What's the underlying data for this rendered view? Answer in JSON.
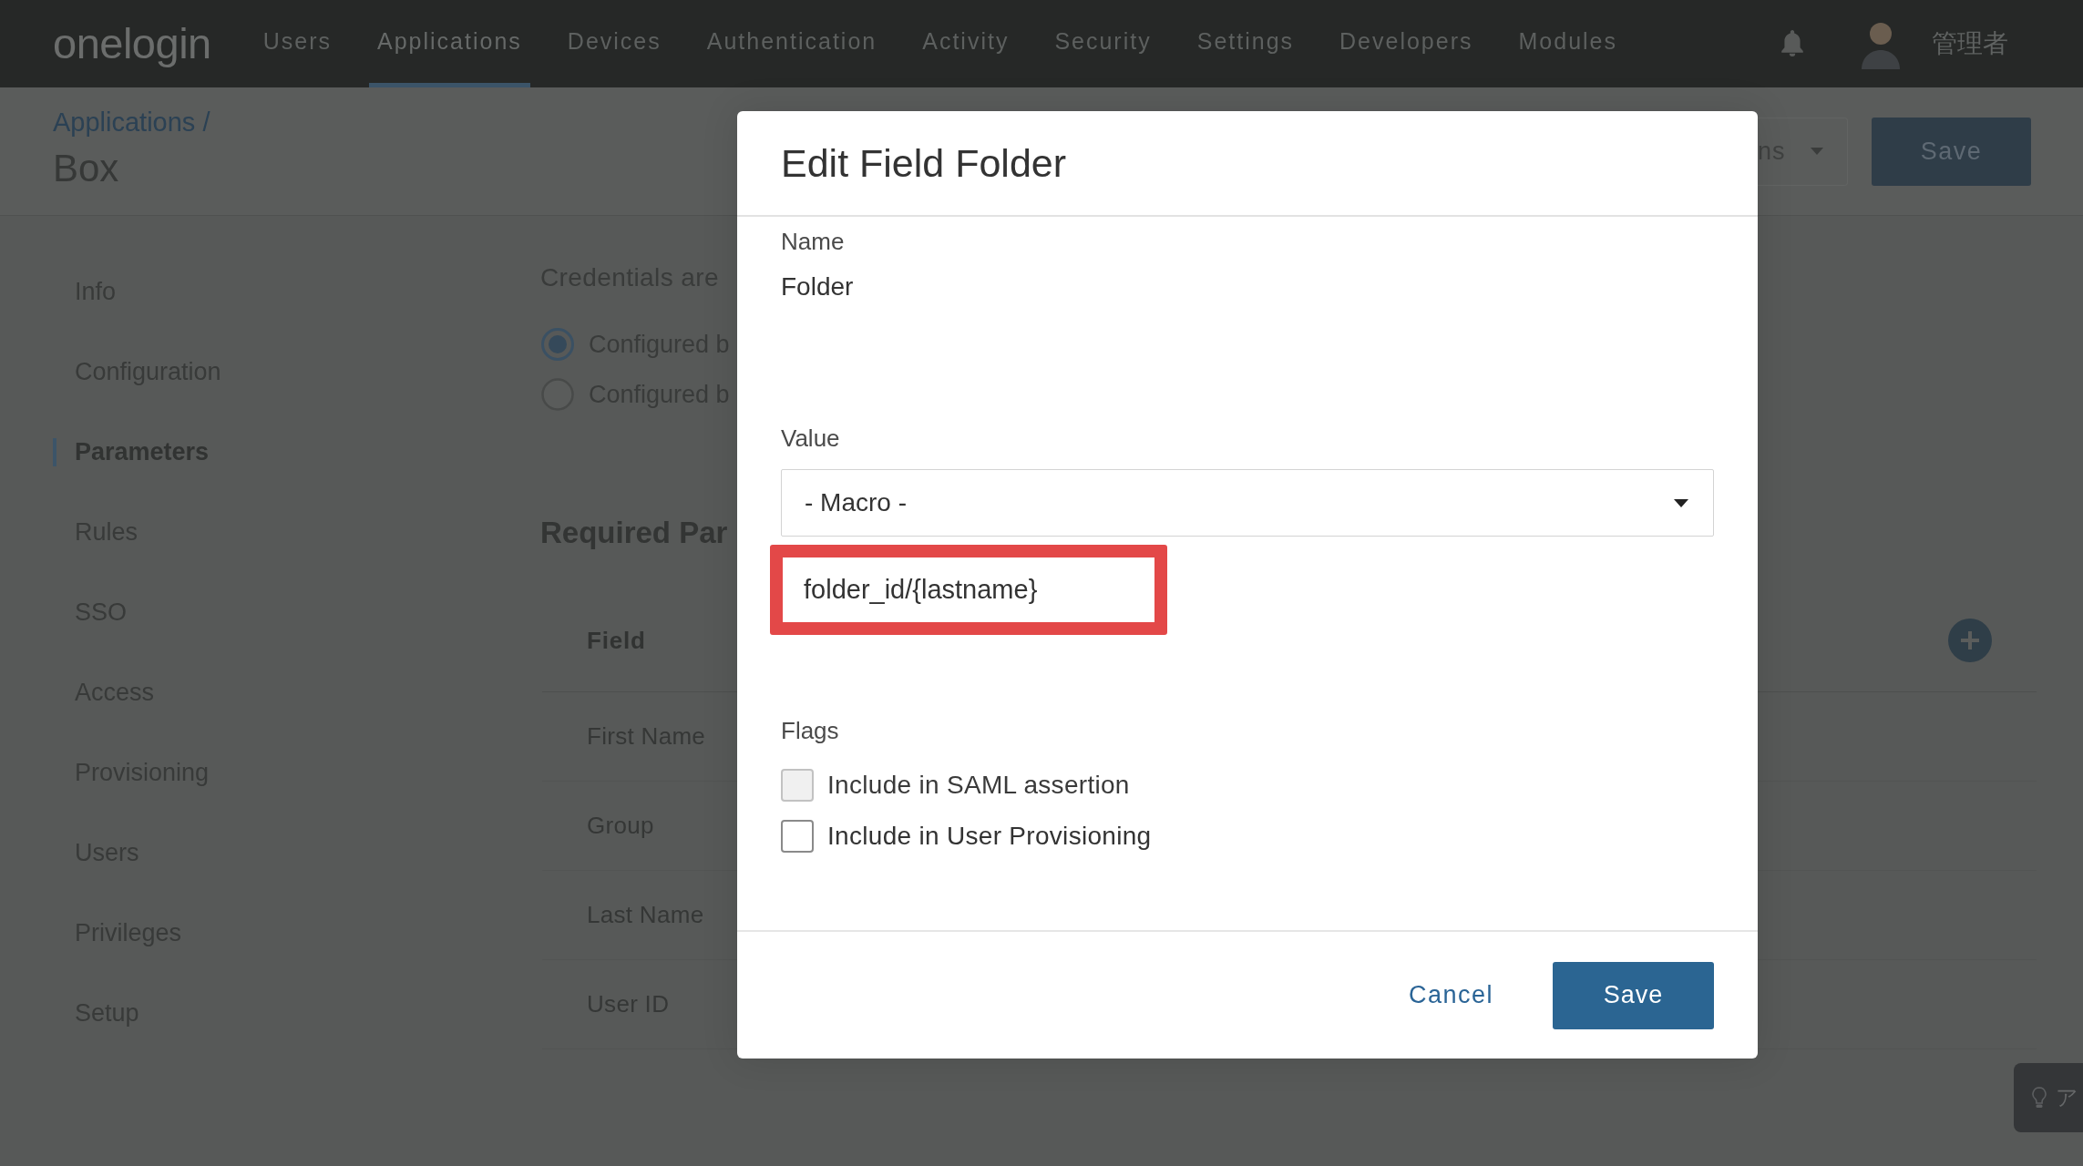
{
  "top_nav": {
    "logo": "onelogin",
    "tabs": [
      {
        "label": "Users",
        "selected": false
      },
      {
        "label": "Applications",
        "selected": true
      },
      {
        "label": "Devices",
        "selected": false
      },
      {
        "label": "Authentication",
        "selected": false
      },
      {
        "label": "Activity",
        "selected": false
      },
      {
        "label": "Security",
        "selected": false
      },
      {
        "label": "Settings",
        "selected": false
      },
      {
        "label": "Developers",
        "selected": false
      },
      {
        "label": "Modules",
        "selected": false
      }
    ],
    "user_name": "管理者"
  },
  "page_header": {
    "breadcrumb": "Applications /",
    "title": "Box",
    "actions_button": "ns",
    "save_button": "Save"
  },
  "sidebar": {
    "items": [
      {
        "label": "Info",
        "selected": false
      },
      {
        "label": "Configuration",
        "selected": false
      },
      {
        "label": "Parameters",
        "selected": true
      },
      {
        "label": "Rules",
        "selected": false
      },
      {
        "label": "SSO",
        "selected": false
      },
      {
        "label": "Access",
        "selected": false
      },
      {
        "label": "Provisioning",
        "selected": false
      },
      {
        "label": "Users",
        "selected": false
      },
      {
        "label": "Privileges",
        "selected": false
      },
      {
        "label": "Setup",
        "selected": false
      }
    ]
  },
  "main": {
    "credentials_label": "Credentials are",
    "credential_options": [
      {
        "label": "Configured b",
        "selected": true
      },
      {
        "label": "Configured b",
        "selected": false
      }
    ],
    "section_title": "Required Par",
    "table": {
      "columns": [
        "Field"
      ],
      "rows": [
        {
          "field": "First Name"
        },
        {
          "field": "Group"
        },
        {
          "field": "Last Name"
        },
        {
          "field": "User ID"
        }
      ]
    }
  },
  "dialog": {
    "title": "Edit Field Folder",
    "name_label": "Name",
    "name_value": "Folder",
    "value_label": "Value",
    "value_select": "- Macro -",
    "macro_input": {
      "value": "folder_id/{lastname}",
      "highlighted": true
    },
    "flags_label": "Flags",
    "flags": [
      {
        "label": "Include in SAML assertion",
        "checked": false,
        "disabled": true
      },
      {
        "label": "Include in User Provisioning",
        "checked": false,
        "disabled": false
      }
    ],
    "buttons": [
      {
        "label": "Cancel",
        "kind": "link"
      },
      {
        "label": "Save",
        "kind": "primary"
      }
    ]
  },
  "hint_tab": {
    "label": "ア"
  }
}
